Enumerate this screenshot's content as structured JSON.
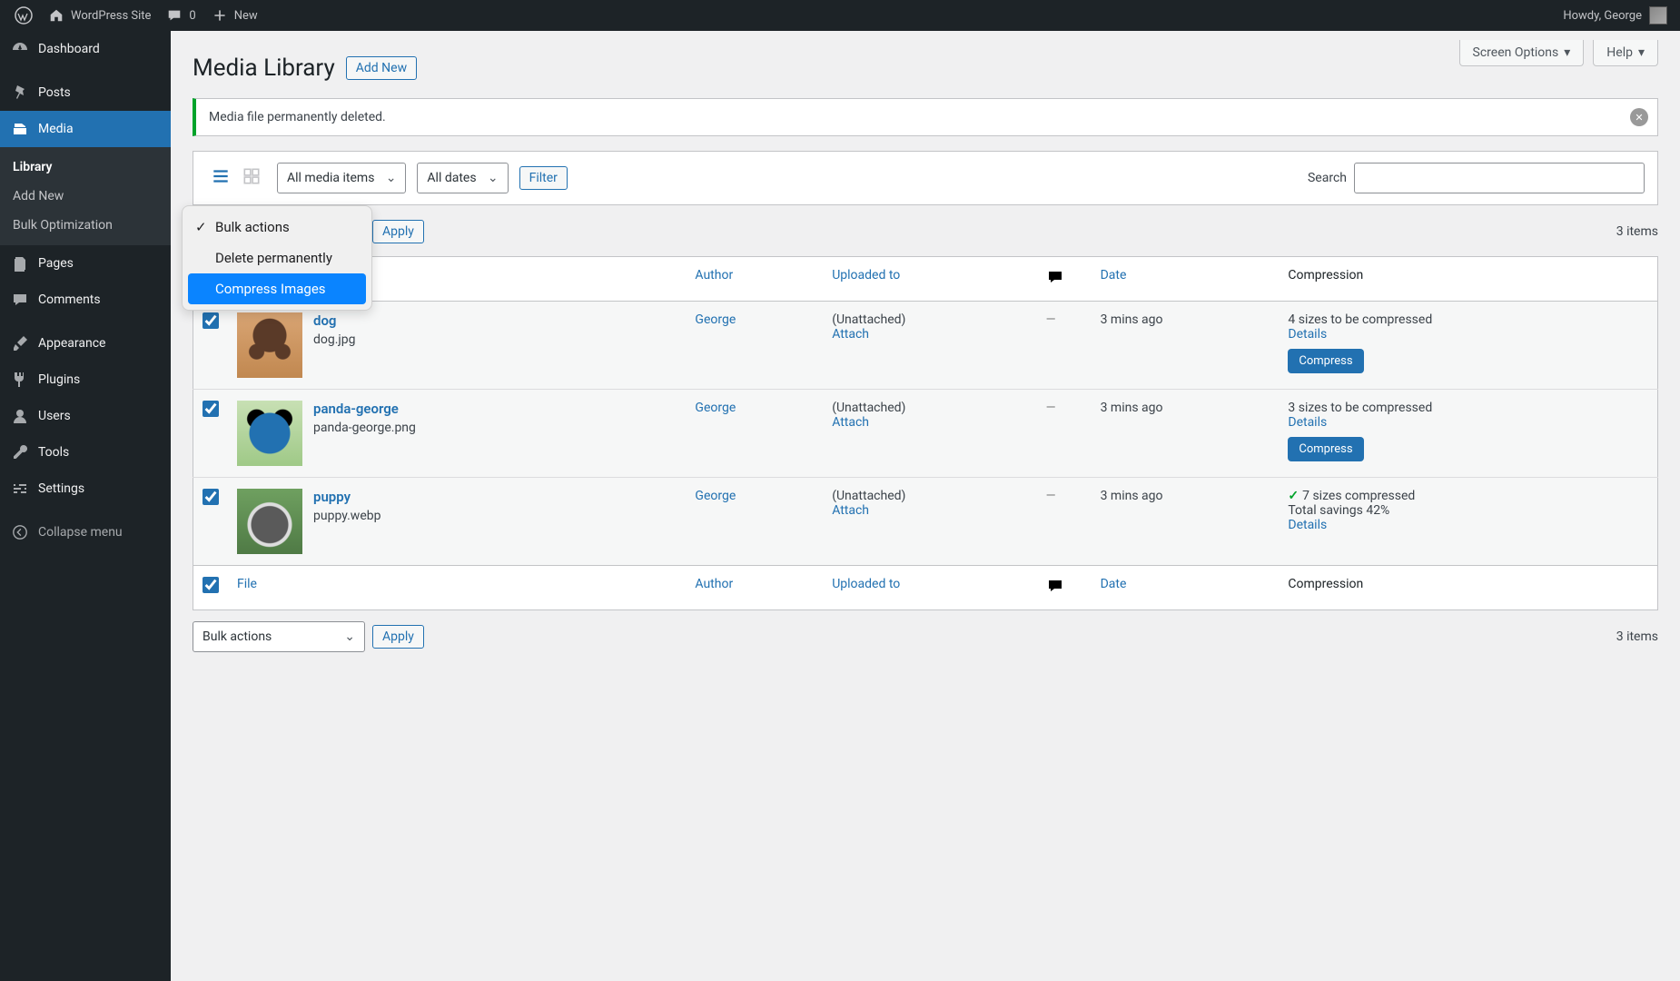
{
  "adminbar": {
    "site_name": "WordPress Site",
    "comments_count": "0",
    "new_label": "New",
    "howdy_prefix": "Howdy, ",
    "user_name": "George"
  },
  "sidebar": {
    "items": [
      {
        "label": "Dashboard",
        "icon": "gauge"
      },
      {
        "label": "Posts",
        "icon": "pin"
      },
      {
        "label": "Media",
        "icon": "media",
        "current": true,
        "sub": [
          {
            "label": "Library",
            "current": true
          },
          {
            "label": "Add New"
          },
          {
            "label": "Bulk Optimization"
          }
        ]
      },
      {
        "label": "Pages",
        "icon": "page"
      },
      {
        "label": "Comments",
        "icon": "comment"
      },
      {
        "label": "Appearance",
        "icon": "brush"
      },
      {
        "label": "Plugins",
        "icon": "plug"
      },
      {
        "label": "Users",
        "icon": "user"
      },
      {
        "label": "Tools",
        "icon": "wrench"
      },
      {
        "label": "Settings",
        "icon": "sliders"
      }
    ],
    "collapse_label": "Collapse menu"
  },
  "header": {
    "screen_options": "Screen Options",
    "help": "Help",
    "page_title": "Media Library",
    "add_new": "Add New"
  },
  "notice": {
    "text": "Media file permanently deleted."
  },
  "filters": {
    "media_type_select": "All media items",
    "date_select": "All dates",
    "filter_btn": "Filter",
    "search_label": "Search"
  },
  "bulk": {
    "select_label": "Bulk actions",
    "apply": "Apply",
    "items_count": "3 items",
    "menu": [
      {
        "label": "Bulk actions",
        "checked": true
      },
      {
        "label": "Delete permanently"
      },
      {
        "label": "Compress Images",
        "highlighted": true
      }
    ]
  },
  "table": {
    "columns": {
      "file": "File",
      "author": "Author",
      "uploaded_to": "Uploaded to",
      "date": "Date",
      "compression": "Compression"
    },
    "rows": [
      {
        "title": "dog",
        "filename": "dog.jpg",
        "author": "George",
        "uploaded_to": "(Unattached)",
        "attach": "Attach",
        "date": "3 mins ago",
        "compression_line": "4 sizes to be compressed",
        "details": "Details",
        "compress_btn": "Compress",
        "thumb": "dog",
        "checked": true
      },
      {
        "title": "panda-george",
        "filename": "panda-george.png",
        "author": "George",
        "uploaded_to": "(Unattached)",
        "attach": "Attach",
        "date": "3 mins ago",
        "compression_line": "3 sizes to be compressed",
        "details": "Details",
        "compress_btn": "Compress",
        "thumb": "panda",
        "checked": true
      },
      {
        "title": "puppy",
        "filename": "puppy.webp",
        "author": "George",
        "uploaded_to": "(Unattached)",
        "attach": "Attach",
        "date": "3 mins ago",
        "compression_line": "7 sizes compressed",
        "compression_line2": "Total savings 42%",
        "details": "Details",
        "compressed": true,
        "thumb": "puppy",
        "checked": true
      }
    ]
  }
}
